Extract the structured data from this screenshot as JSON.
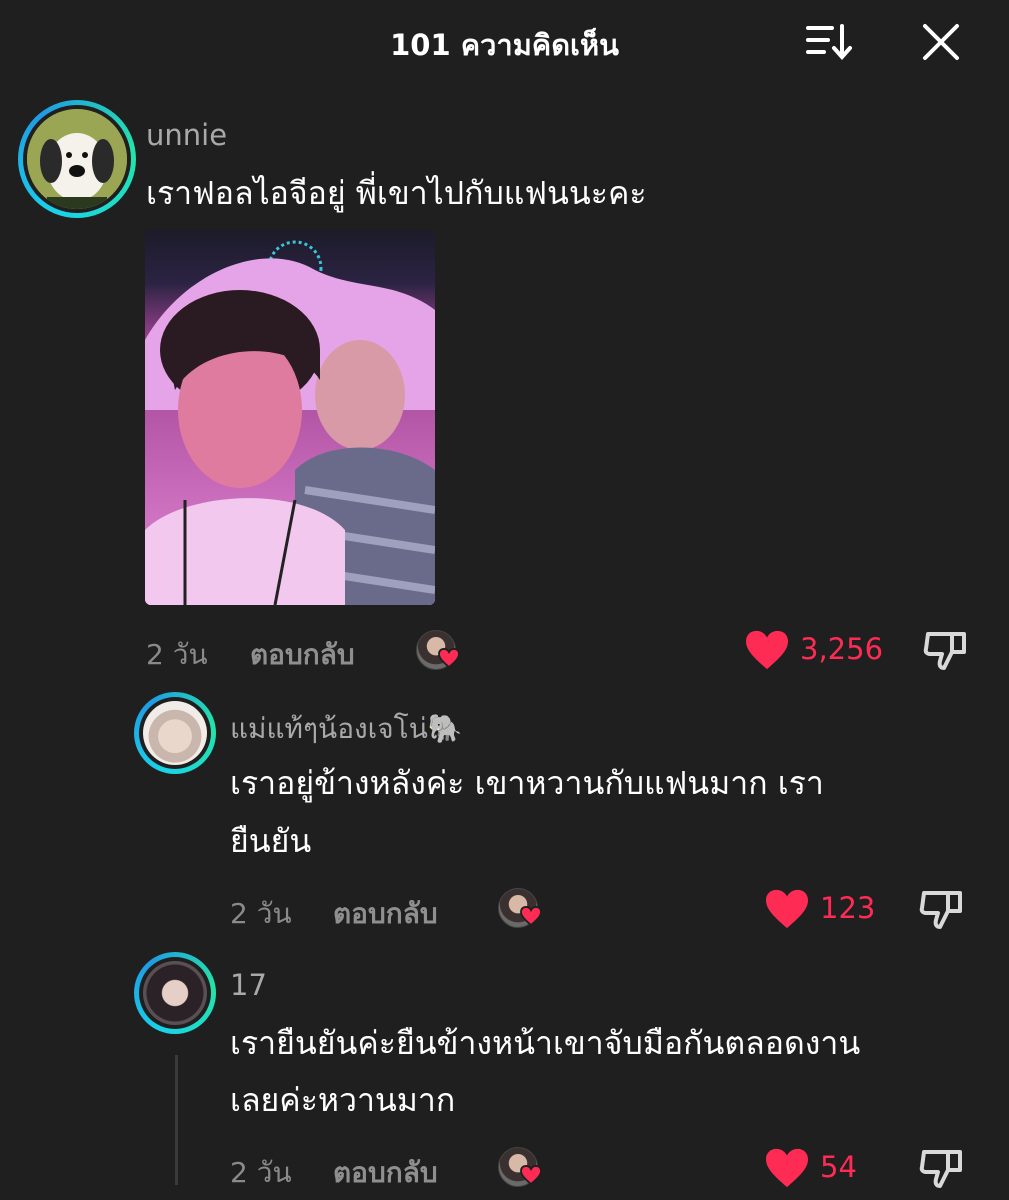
{
  "header": {
    "title": "101 ความคิดเห็น",
    "sort_icon": "sort-descending-icon",
    "close_icon": "close-icon"
  },
  "comments": [
    {
      "username": "unnie",
      "text": "เราฟอลไอจีอยู่ พี่เขาไปกับแฟนนะคะ",
      "has_image": true,
      "time": "2 วัน",
      "reply_label": "ตอบกลับ",
      "likes": "3,256"
    },
    {
      "username": "แม่แท้ๆน้องเจโน่🐘",
      "text_lines": [
        "เราอยู่ข้างหลังค่ะ เขาหวานกับแฟนมาก เรา",
        "ยืนยัน"
      ],
      "time": "2 วัน",
      "reply_label": "ตอบกลับ",
      "likes": "123"
    },
    {
      "username": "17",
      "text_lines": [
        "เรายืนยันค่ะยืนข้างหน้าเขาจับมือกันตลอดงาน",
        "เลยค่ะหวานมาก"
      ],
      "time": "2 วัน",
      "reply_label": "ตอบกลับ",
      "likes": "54"
    }
  ],
  "colors": {
    "background": "#1f1f1f",
    "like_red": "#fe2c55",
    "avatar_ring": "#19d3e8"
  }
}
